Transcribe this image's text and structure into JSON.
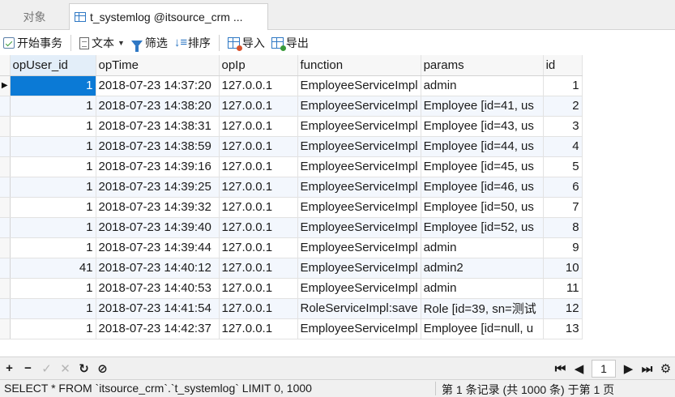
{
  "tabs": {
    "objects": "对象",
    "table": "t_systemlog @itsource_crm ..."
  },
  "toolbar": {
    "begin_tx": "开始事务",
    "text": "文本",
    "filter": "筛选",
    "sort": "排序",
    "import": "导入",
    "export": "导出"
  },
  "grid": {
    "columns": [
      "opUser_id",
      "opTime",
      "opIp",
      "function",
      "params",
      "id"
    ],
    "rows": [
      [
        "1",
        "2018-07-23 14:37:20",
        "127.0.0.1",
        "EmployeeServiceImpl",
        "admin",
        "1"
      ],
      [
        "1",
        "2018-07-23 14:38:20",
        "127.0.0.1",
        "EmployeeServiceImpl",
        "Employee [id=41, us",
        "2"
      ],
      [
        "1",
        "2018-07-23 14:38:31",
        "127.0.0.1",
        "EmployeeServiceImpl",
        "Employee [id=43, us",
        "3"
      ],
      [
        "1",
        "2018-07-23 14:38:59",
        "127.0.0.1",
        "EmployeeServiceImpl",
        "Employee [id=44, us",
        "4"
      ],
      [
        "1",
        "2018-07-23 14:39:16",
        "127.0.0.1",
        "EmployeeServiceImpl",
        "Employee [id=45, us",
        "5"
      ],
      [
        "1",
        "2018-07-23 14:39:25",
        "127.0.0.1",
        "EmployeeServiceImpl",
        "Employee [id=46, us",
        "6"
      ],
      [
        "1",
        "2018-07-23 14:39:32",
        "127.0.0.1",
        "EmployeeServiceImpl",
        "Employee [id=50, us",
        "7"
      ],
      [
        "1",
        "2018-07-23 14:39:40",
        "127.0.0.1",
        "EmployeeServiceImpl",
        "Employee [id=52, us",
        "8"
      ],
      [
        "1",
        "2018-07-23 14:39:44",
        "127.0.0.1",
        "EmployeeServiceImpl",
        "admin",
        "9"
      ],
      [
        "41",
        "2018-07-23 14:40:12",
        "127.0.0.1",
        "EmployeeServiceImpl",
        "admin2",
        "10"
      ],
      [
        "1",
        "2018-07-23 14:40:53",
        "127.0.0.1",
        "EmployeeServiceImpl",
        "admin",
        "11"
      ],
      [
        "1",
        "2018-07-23 14:41:54",
        "127.0.0.1",
        "RoleServiceImpl:save",
        "Role [id=39, sn=测试",
        "12"
      ],
      [
        "1",
        "2018-07-23 14:42:37",
        "127.0.0.1",
        "EmployeeServiceImpl",
        "Employee [id=null, u",
        "13"
      ]
    ],
    "current_row_marker": "▶"
  },
  "nav": {
    "add": "+",
    "delete": "−",
    "apply": "✓",
    "discard": "✕",
    "refresh": "↻",
    "stop": "⊘",
    "first": "⏮",
    "prev": "◀",
    "page": "1",
    "next": "▶",
    "last": "⏭",
    "settings": "⚙"
  },
  "status": {
    "sql": "SELECT * FROM `itsource_crm`.`t_systemlog` LIMIT 0, 1000",
    "record_info": "第 1 条记录 (共 1000 条) 于第 1 页"
  },
  "colors": {
    "selection": "#0b7ad6",
    "accent": "#2f78c4",
    "alt_row": "#f3f7fd"
  }
}
